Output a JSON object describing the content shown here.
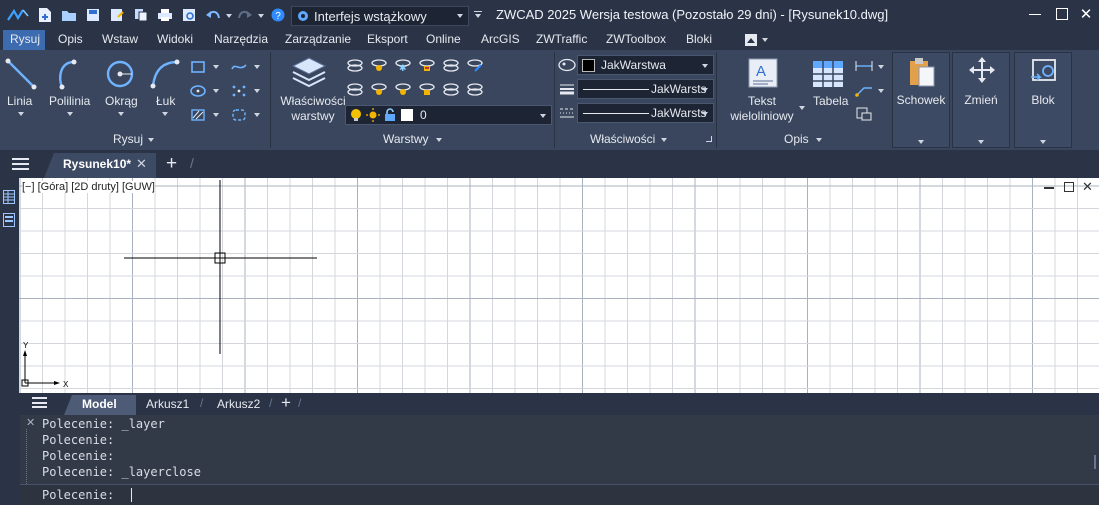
{
  "app": {
    "title": "ZWCAD 2025 Wersja testowa (Pozostało 29 dni) - [Rysunek10.dwg]",
    "workspace": "Interfejs wstążkowy"
  },
  "menu": [
    "Rysuj",
    "Opis",
    "Wstaw",
    "Widoki",
    "Narzędzia",
    "Zarządzanie",
    "Eksport",
    "Online",
    "ArcGIS",
    "ZWTraffic",
    "ZWToolbox",
    "Bloki"
  ],
  "ribbon": {
    "draw": {
      "line": "Linia",
      "polyline": "Polilinia",
      "circle": "Okrąg",
      "arc": "Łuk",
      "panel": "Rysuj"
    },
    "layers": {
      "properties_l1": "Właściwości",
      "properties_l2": "warstwy",
      "current_layer": "0",
      "panel": "Warstwy"
    },
    "properties": {
      "color": "JakWarstwa",
      "linetype": "JakWarsts",
      "lineweight": "JakWarsts",
      "panel": "Właściwości"
    },
    "annotation": {
      "mtext_l1": "Tekst",
      "mtext_l2": "wieloliniowy",
      "table": "Tabela",
      "panel": "Opis"
    },
    "clipboard": "Schowek",
    "modify": "Zmień",
    "block": "Blok"
  },
  "document": {
    "tab": "Rysunek10*"
  },
  "viewport": {
    "label": "[−] [Góra] [2D druty] [GUW]"
  },
  "ucs": {
    "x": "X",
    "y": "Y"
  },
  "layouts": [
    "Model",
    "Arkusz1",
    "Arkusz2"
  ],
  "command": {
    "history": [
      "Polecenie: _layer",
      "Polecenie:",
      "Polecenie:",
      "Polecenie: _layerclose"
    ],
    "prompt": "Polecenie:"
  },
  "colors": {
    "accent": "#3d6bb0",
    "ribbon": "#39465e",
    "chrome": "#2b3446",
    "grid": "#b9bec6",
    "canvas": "#ffffff"
  }
}
